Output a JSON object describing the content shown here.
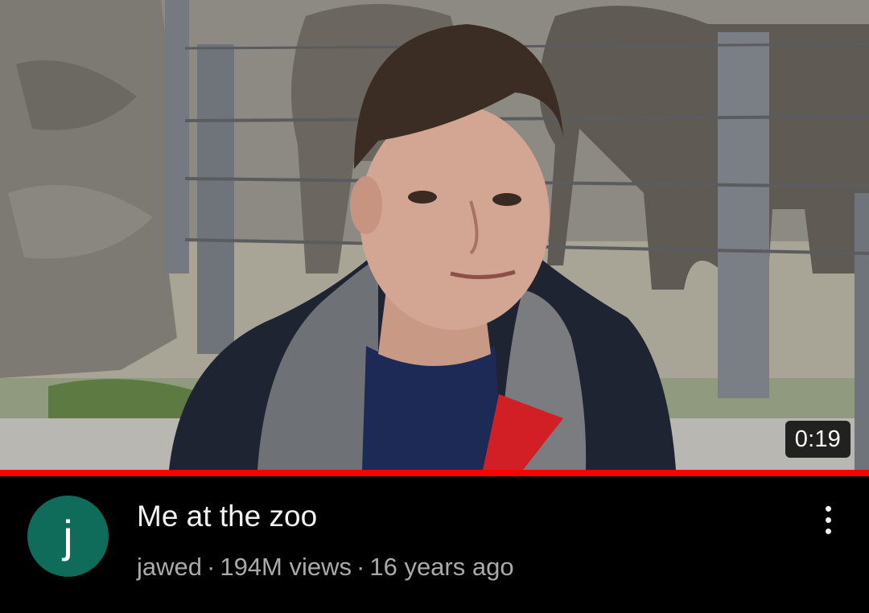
{
  "video": {
    "duration": "0:19",
    "progress_watched": 1.0,
    "thumbnail_description": "young man in front of elephant enclosure at zoo"
  },
  "channel": {
    "avatar_letter": "j",
    "avatar_color": "#0f6b5a",
    "name": "jawed"
  },
  "title": "Me at the zoo",
  "meta": {
    "separator": "·",
    "views": "194M views",
    "age": "16 years ago"
  },
  "menu_icon": "more-vert-icon",
  "colors": {
    "background": "#000000",
    "progress": "#ff0000",
    "title": "#f1f1f1",
    "meta": "#aaaaaa"
  }
}
